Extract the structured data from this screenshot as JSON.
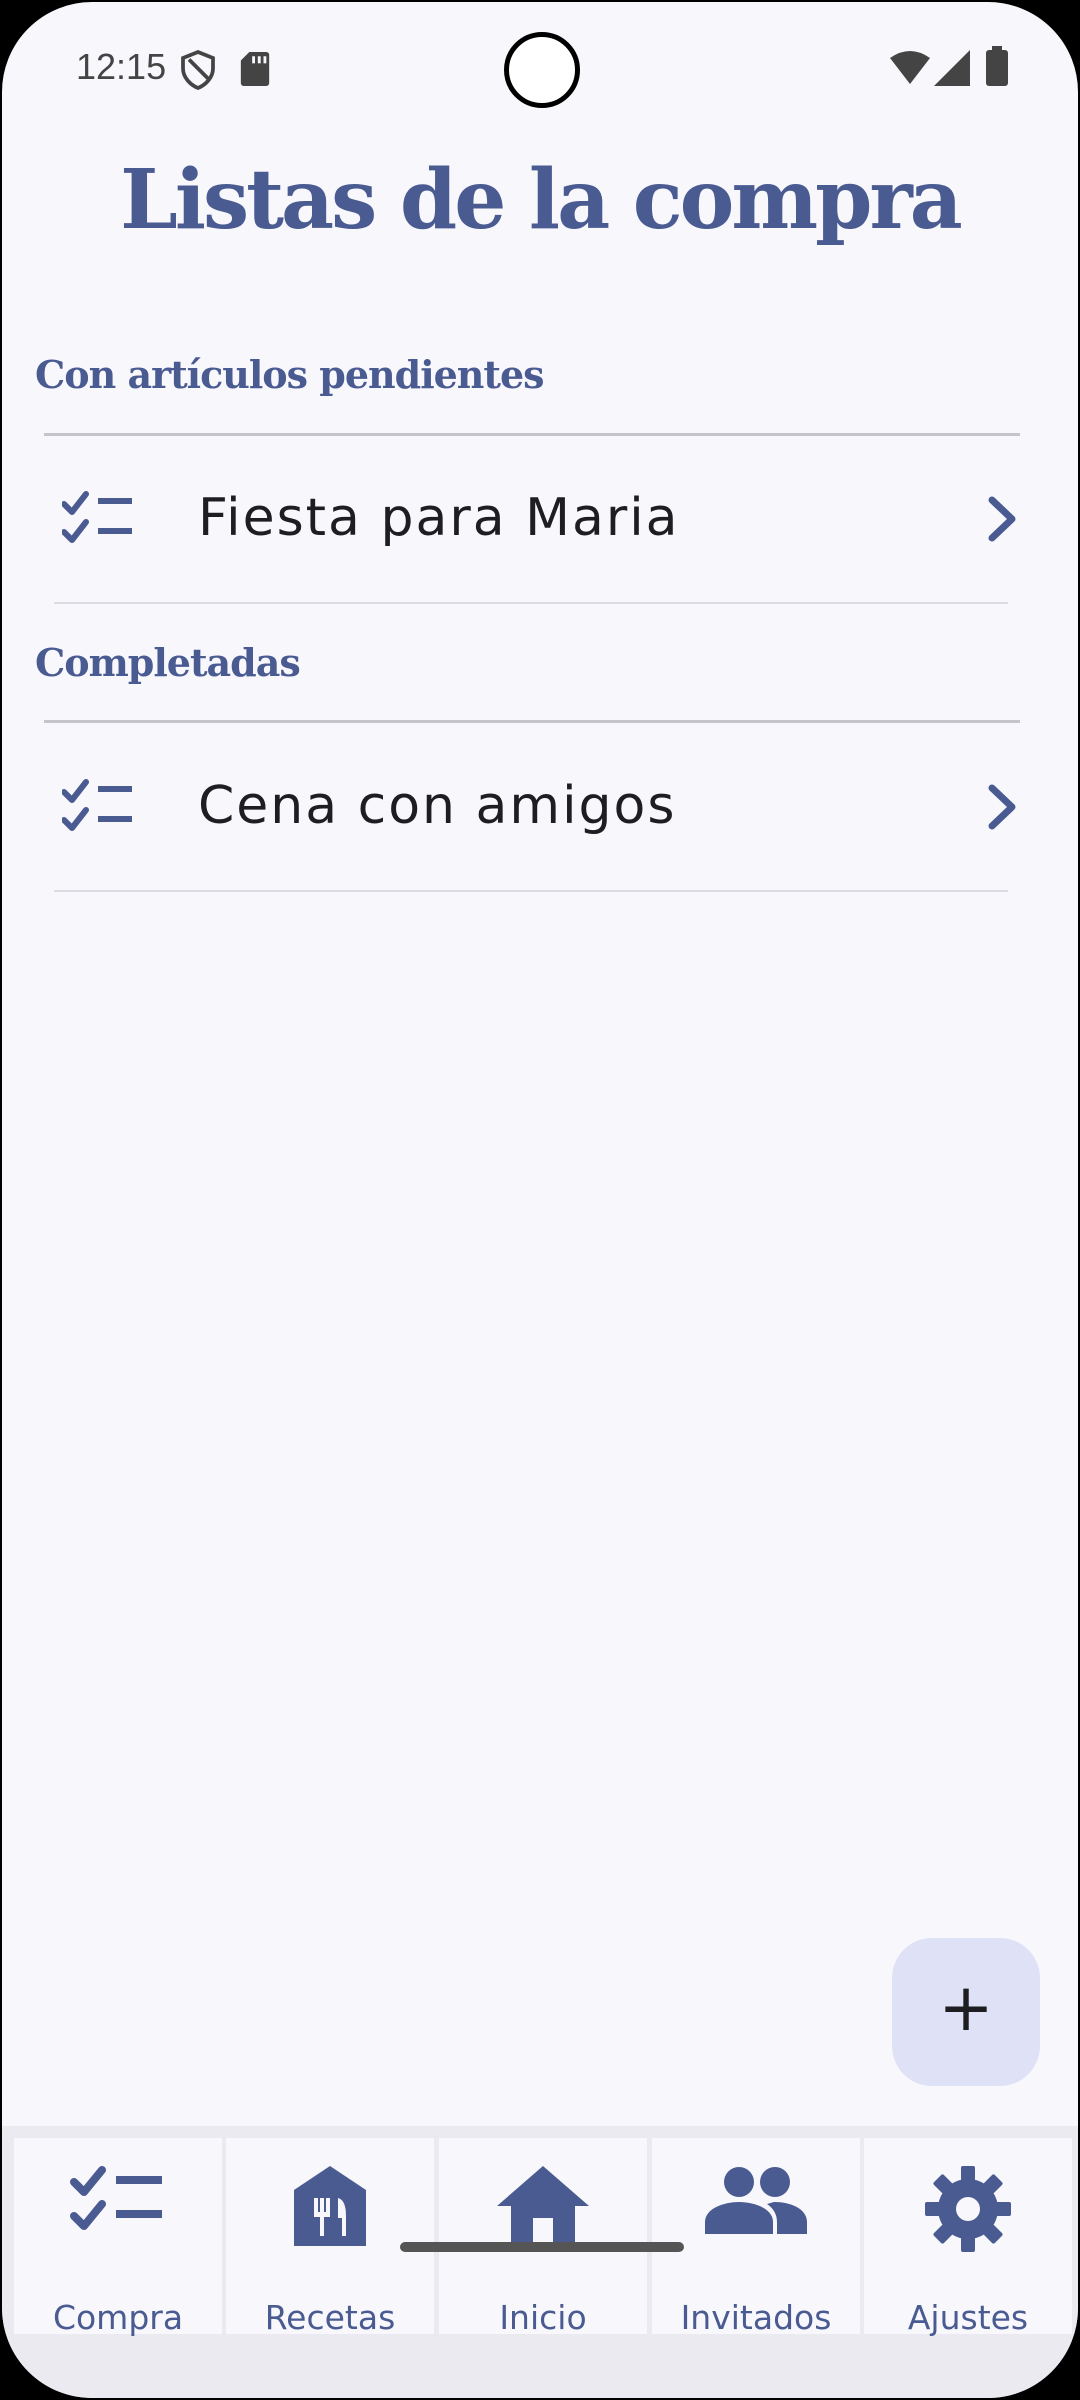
{
  "status_bar": {
    "time": "12:15",
    "icons": [
      "shield-icon",
      "sd-card-icon",
      "wifi-icon",
      "signal-icon",
      "battery-icon"
    ]
  },
  "header": {
    "title": "Listas de la compra"
  },
  "sections": [
    {
      "label": "Con artículos pendientes",
      "items": [
        {
          "label": "Fiesta para Maria",
          "icon": "checklist-icon"
        }
      ]
    },
    {
      "label": "Completadas",
      "items": [
        {
          "label": "Cena con amigos",
          "icon": "checklist-icon"
        }
      ]
    }
  ],
  "fab": {
    "label": "+",
    "icon": "add-icon"
  },
  "bottom_nav": {
    "items": [
      {
        "label": "Compra",
        "icon": "checklist-icon"
      },
      {
        "label": "Recetas",
        "icon": "restaurant-icon"
      },
      {
        "label": "Inicio",
        "icon": "home-icon"
      },
      {
        "label": "Invitados",
        "icon": "people-icon"
      },
      {
        "label": "Ajustes",
        "icon": "gear-icon"
      }
    ]
  },
  "colors": {
    "accent": "#4a5b92",
    "background": "#f8f7fc",
    "fab_bg": "#dfe2f6",
    "nav_bg": "#ebeaf1"
  }
}
